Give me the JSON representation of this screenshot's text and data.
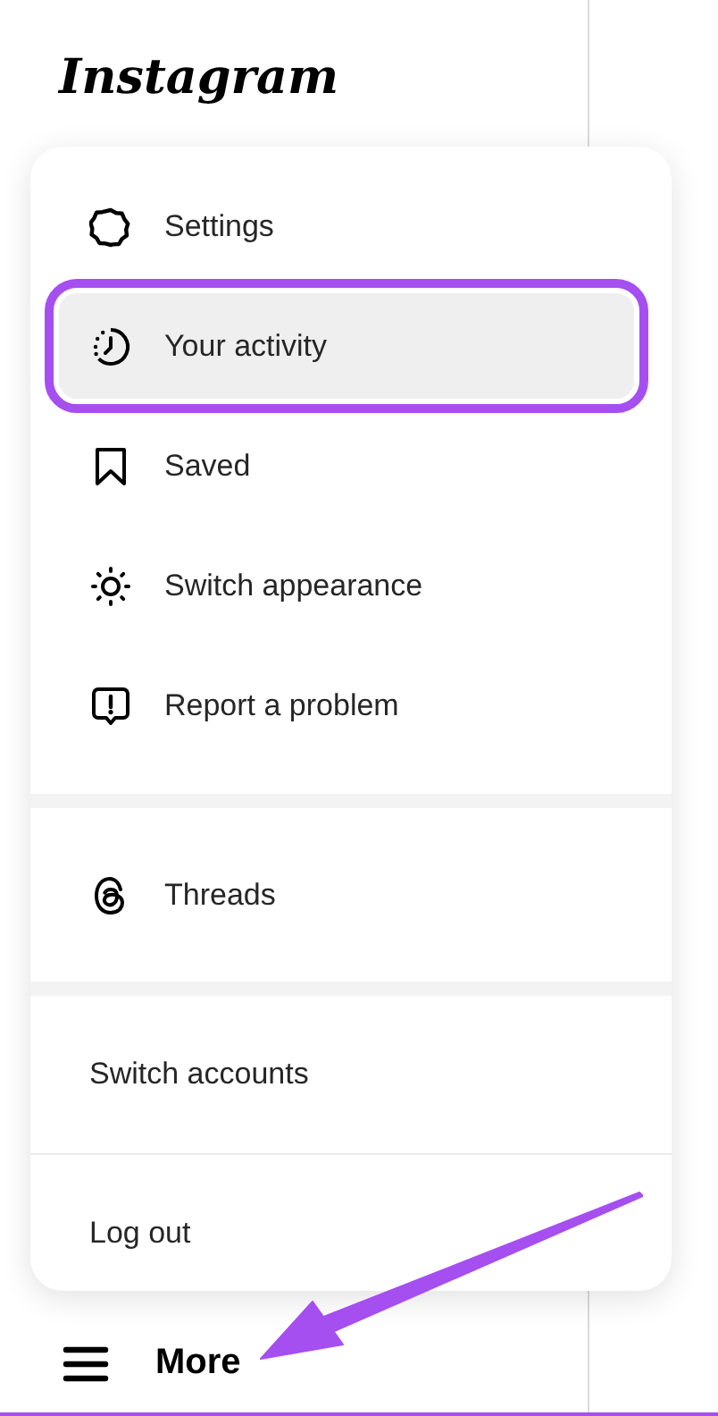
{
  "logo": "Instagram",
  "menu": {
    "sections": [
      {
        "items": [
          {
            "label": "Settings",
            "selected": false
          },
          {
            "label": "Your activity",
            "selected": true
          },
          {
            "label": "Saved",
            "selected": false
          },
          {
            "label": "Switch appearance",
            "selected": false
          },
          {
            "label": "Report a problem",
            "selected": false
          }
        ]
      },
      {
        "items": [
          {
            "label": "Threads",
            "selected": false
          }
        ]
      },
      {
        "items": [
          {
            "label": "Switch accounts",
            "selected": false
          },
          {
            "label": "Log out",
            "selected": false
          }
        ]
      }
    ]
  },
  "nav_item": {
    "label": "More"
  }
}
